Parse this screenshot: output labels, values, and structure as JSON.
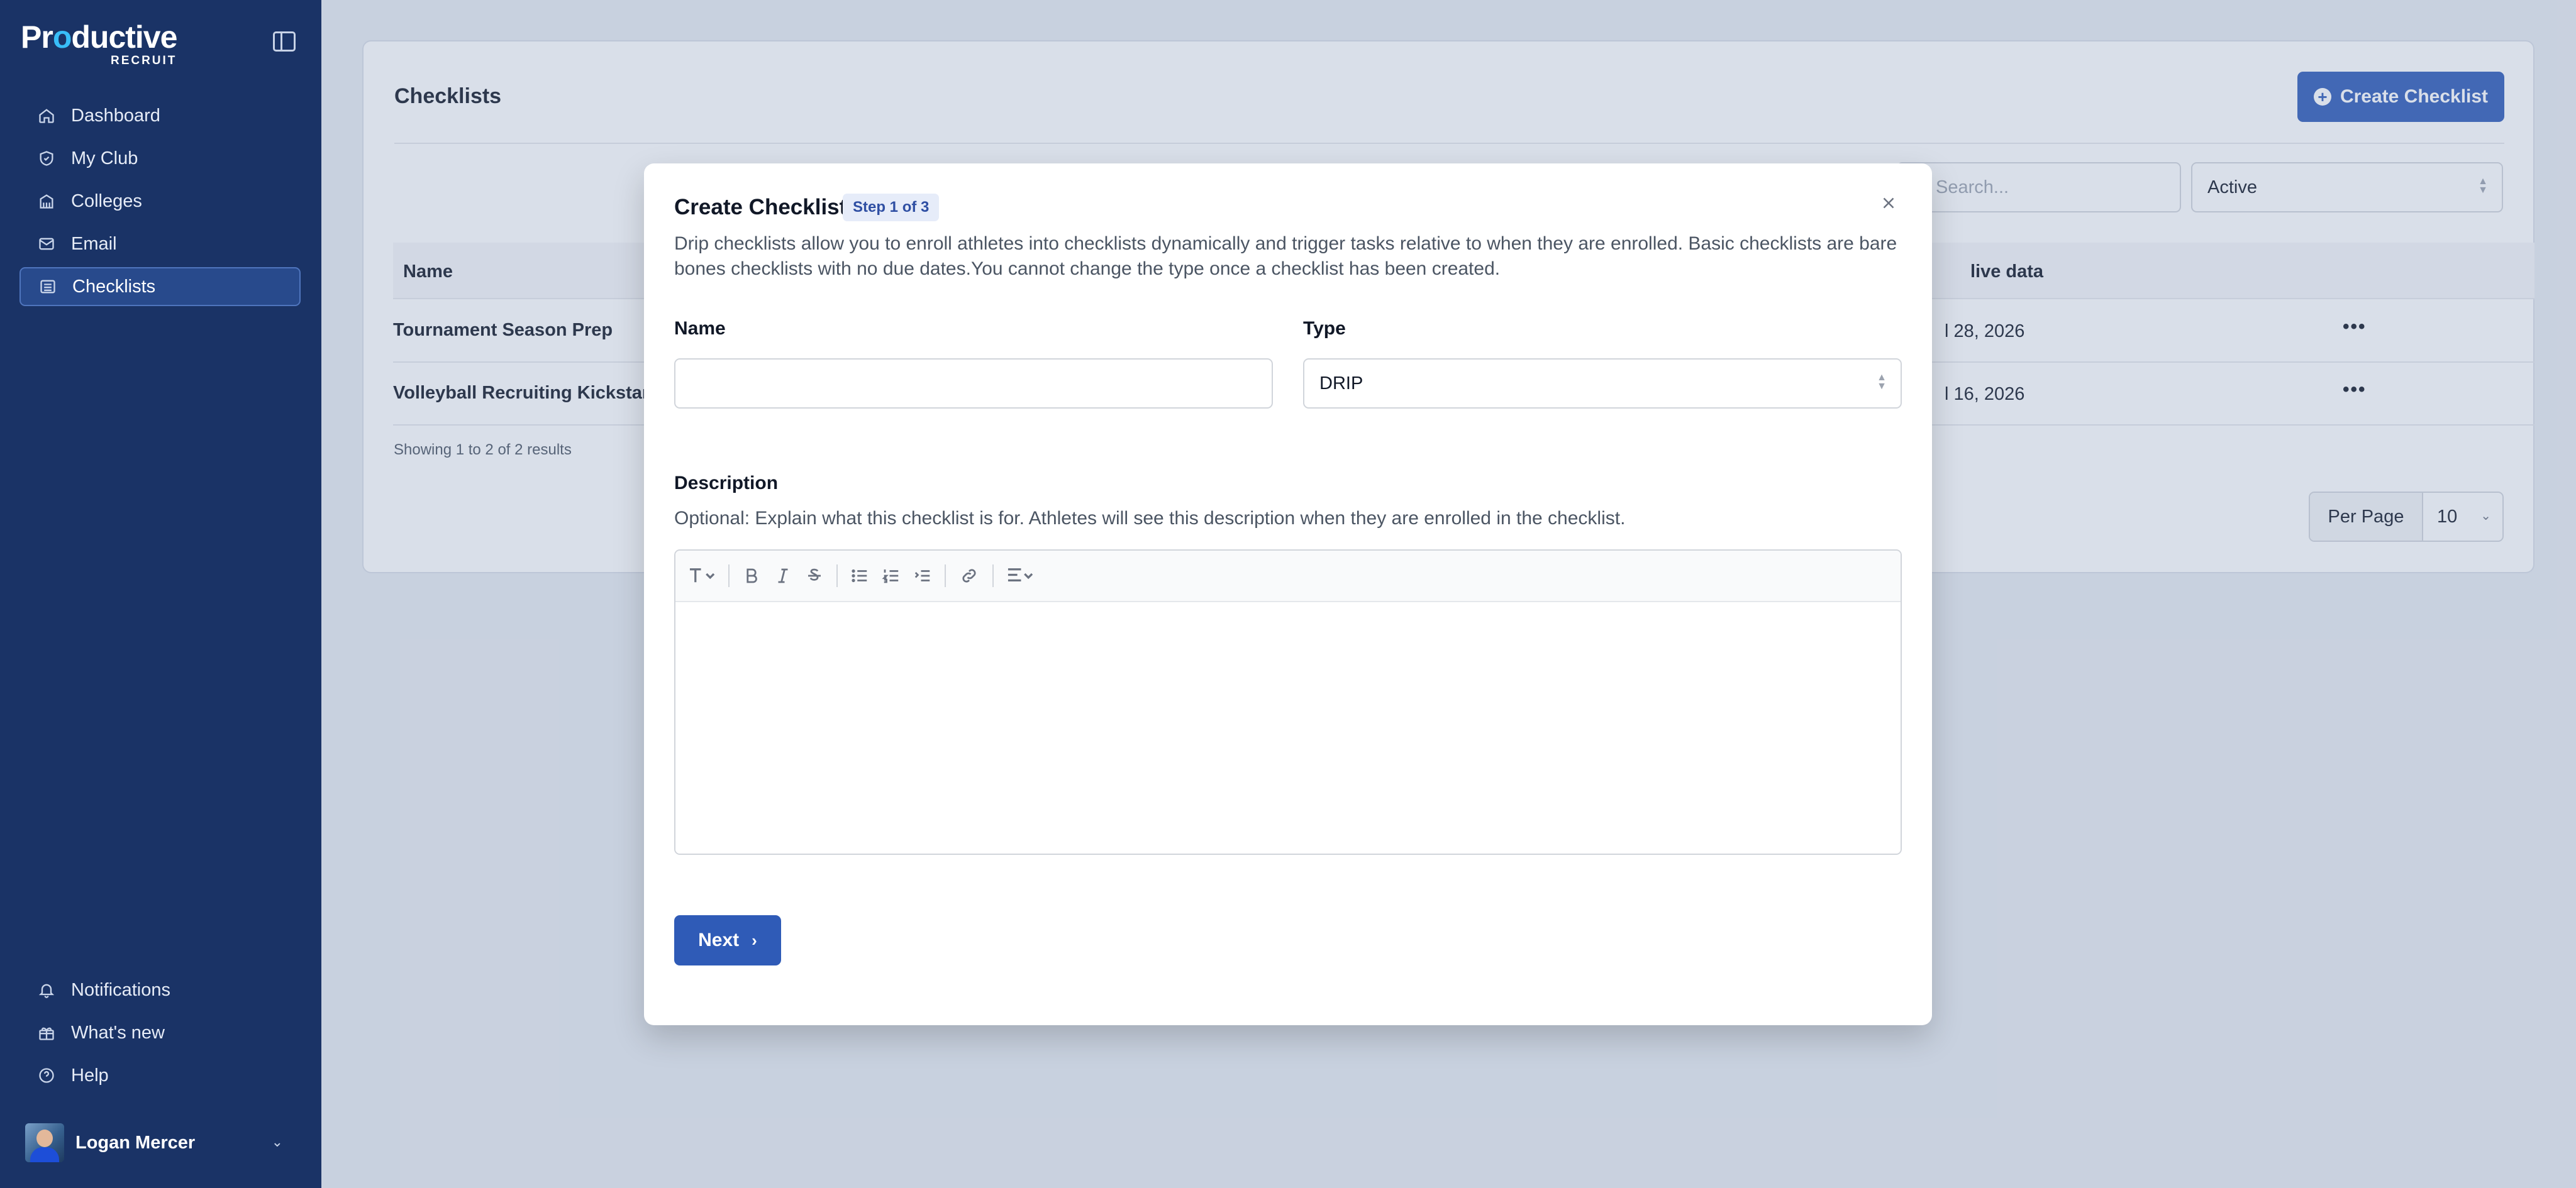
{
  "brand": {
    "name_prefix": "Pr",
    "name_o": "o",
    "name_suffix": "ductive",
    "sub": "RECRUIT"
  },
  "sidebar": {
    "items": [
      {
        "label": "Dashboard",
        "icon": "home-icon"
      },
      {
        "label": "My Club",
        "icon": "shield-icon"
      },
      {
        "label": "Colleges",
        "icon": "building-icon"
      },
      {
        "label": "Email",
        "icon": "mail-icon"
      },
      {
        "label": "Checklists",
        "icon": "list-icon",
        "active": true
      }
    ],
    "bottom_items": [
      {
        "label": "Notifications",
        "icon": "bell-icon"
      },
      {
        "label": "What's new",
        "icon": "gift-icon"
      },
      {
        "label": "Help",
        "icon": "help-icon"
      }
    ],
    "user": {
      "name": "Logan Mercer"
    }
  },
  "page": {
    "title": "Checklists",
    "create_button": "Create Checklist",
    "search_placeholder": "Search...",
    "status_filter": "Active",
    "table": {
      "columns": [
        "Name",
        "live data"
      ],
      "rows": [
        {
          "name": "Tournament Season Prep",
          "date": "l 28, 2026"
        },
        {
          "name": "Volleyball Recruiting Kickstart",
          "date": "l 16, 2026"
        }
      ]
    },
    "results_text": "Showing 1 to 2 of 2 results",
    "per_page_label": "Per Page",
    "per_page_value": "10"
  },
  "modal": {
    "title": "Create Checklist",
    "step": "Step 1 of 3",
    "description": "Drip checklists allow you to enroll athletes into checklists dynamically and trigger tasks relative to when they are enrolled. Basic checklists are bare bones checklists with no due dates.You cannot change the type once a checklist has been created.",
    "name_label": "Name",
    "name_value": "",
    "type_label": "Type",
    "type_value": "DRIP",
    "description_label": "Description",
    "description_help": "Optional: Explain what this checklist is for. Athletes will see this description when they are enrolled in the checklist.",
    "next_button": "Next"
  },
  "colors": {
    "sidebar": "#1a3366",
    "primary": "#2f5bb7",
    "accent": "#38bdf8"
  }
}
